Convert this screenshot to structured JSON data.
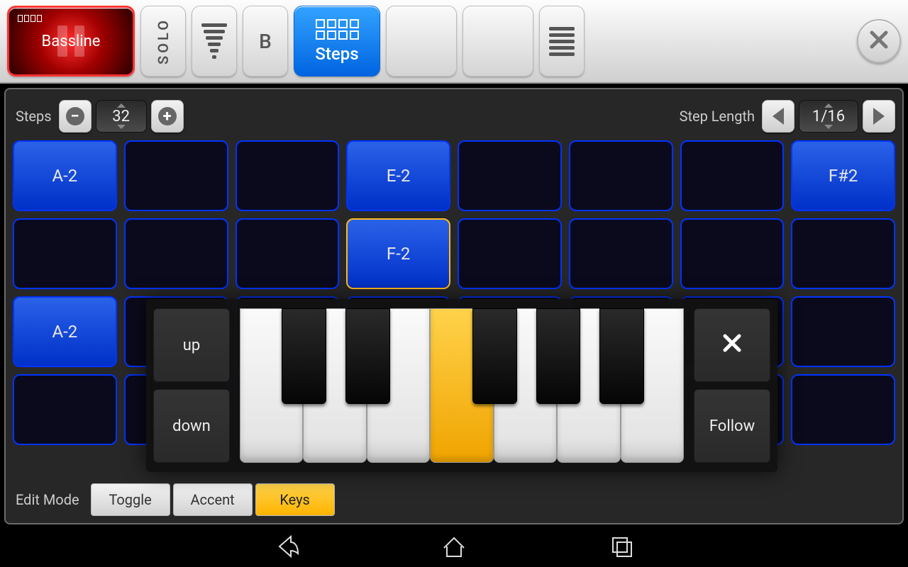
{
  "toolbar": {
    "track_label": "Bassline",
    "solo_label": "SOLO",
    "pattern_label": "B",
    "steps_label": "Steps"
  },
  "controls": {
    "steps_label": "Steps",
    "steps_value": "32",
    "steplen_label": "Step Length",
    "steplen_value": "1/16"
  },
  "grid": {
    "rows": [
      [
        {
          "t": "A-2",
          "f": true
        },
        {
          "t": "",
          "f": false
        },
        {
          "t": "",
          "f": false
        },
        {
          "t": "E-2",
          "f": true
        },
        {
          "t": "",
          "f": false
        },
        {
          "t": "",
          "f": false
        },
        {
          "t": "",
          "f": false
        },
        {
          "t": "F#2",
          "f": true
        }
      ],
      [
        {
          "t": "",
          "f": false
        },
        {
          "t": "",
          "f": false
        },
        {
          "t": "",
          "f": false
        },
        {
          "t": "F-2",
          "f": true,
          "sel": true
        },
        {
          "t": "",
          "f": false
        },
        {
          "t": "",
          "f": false
        },
        {
          "t": "",
          "f": false
        },
        {
          "t": "",
          "f": false
        }
      ],
      [
        {
          "t": "A-2",
          "f": true
        },
        {
          "t": "",
          "f": false
        },
        {
          "t": "",
          "f": false
        },
        {
          "t": "",
          "f": false
        },
        {
          "t": "",
          "f": false
        },
        {
          "t": "",
          "f": false
        },
        {
          "t": "",
          "f": false
        },
        {
          "t": "",
          "f": false
        }
      ],
      [
        {
          "t": "",
          "f": false
        },
        {
          "t": "",
          "f": false
        },
        {
          "t": "",
          "f": false
        },
        {
          "t": "",
          "f": false
        },
        {
          "t": "",
          "f": false
        },
        {
          "t": "",
          "f": false
        },
        {
          "t": "",
          "f": false
        },
        {
          "t": "",
          "f": false
        }
      ]
    ]
  },
  "popup": {
    "up": "up",
    "down": "down",
    "follow": "Follow",
    "close_icon": "close-icon",
    "selected_white_index": 3,
    "white_count": 7,
    "black_positions": [
      0.095,
      0.238,
      0.524,
      0.667,
      0.81
    ]
  },
  "editmode": {
    "label": "Edit Mode",
    "toggle": "Toggle",
    "accent": "Accent",
    "keys": "Keys",
    "active": "keys"
  }
}
